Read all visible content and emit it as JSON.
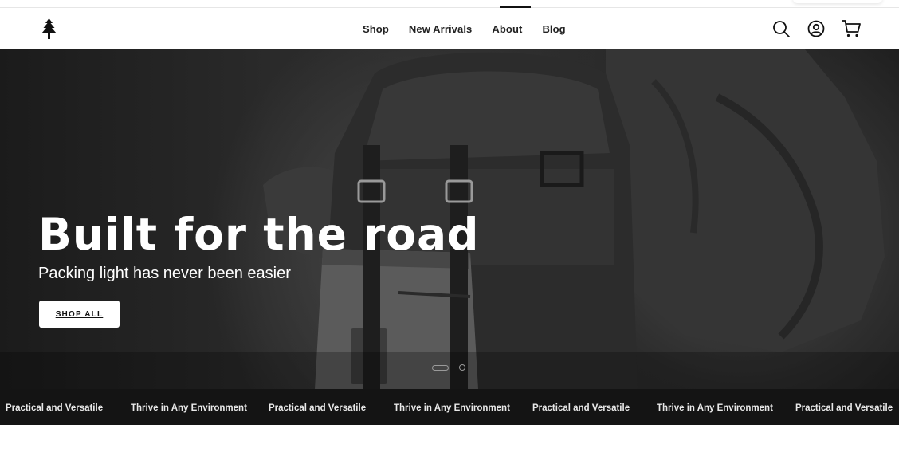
{
  "nav": {
    "logo_icon": "pine-tree-icon",
    "links": [
      {
        "label": "Shop"
      },
      {
        "label": "New Arrivals"
      },
      {
        "label": "About"
      },
      {
        "label": "Blog"
      }
    ],
    "icons": [
      "search-icon",
      "account-icon",
      "cart-icon"
    ]
  },
  "hero": {
    "title": "Built for the road",
    "subtitle": "Packing light has never been easier",
    "cta_label": "SHOP ALL",
    "slides_total": 2,
    "active_slide": 1
  },
  "ticker": {
    "items": [
      "Practical and Versatile",
      "Thrive in Any Environment",
      "Practical and Versatile",
      "Thrive in Any Environment",
      "Practical and Versatile",
      "Thrive in Any Environment",
      "Practical and Versatile"
    ]
  },
  "colors": {
    "header_bg": "#ffffff",
    "ticker_bg": "#141414",
    "hero_text": "#ffffff",
    "cta_bg": "#ffffff"
  }
}
